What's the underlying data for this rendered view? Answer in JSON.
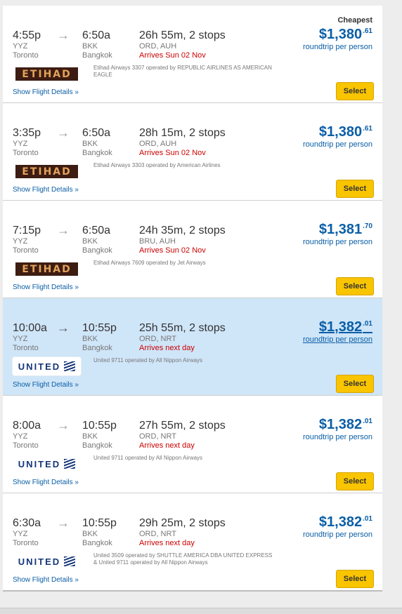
{
  "results": [
    {
      "badge": "Cheapest",
      "dep_time": "4:55p",
      "dep_code": "YYZ",
      "dep_city": "Toronto",
      "arr_time": "6:50a",
      "arr_code": "BKK",
      "arr_city": "Bangkok",
      "duration": "26h 55m, 2 stops",
      "via": "ORD, AUH",
      "arrives": "Arrives Sun 02 Nov",
      "price_main": "$1,380",
      "price_cents": ".61",
      "price_note": "roundtrip per person",
      "airline_logo": "ETIHAD",
      "operated": "Etihad Airways 3307 operated by REPUBLIC AIRLINES AS AMERICAN EAGLE",
      "details_link": "Show Flight Details",
      "select_label": "Select"
    },
    {
      "badge": "",
      "dep_time": "3:35p",
      "dep_code": "YYZ",
      "dep_city": "Toronto",
      "arr_time": "6:50a",
      "arr_code": "BKK",
      "arr_city": "Bangkok",
      "duration": "28h 15m, 2 stops",
      "via": "ORD, AUH",
      "arrives": "Arrives Sun 02 Nov",
      "price_main": "$1,380",
      "price_cents": ".61",
      "price_note": "roundtrip per person",
      "airline_logo": "ETIHAD",
      "operated": "Etihad Airways 3303 operated by American Airlines",
      "details_link": "Show Flight Details",
      "select_label": "Select"
    },
    {
      "badge": "",
      "dep_time": "7:15p",
      "dep_code": "YYZ",
      "dep_city": "Toronto",
      "arr_time": "6:50a",
      "arr_code": "BKK",
      "arr_city": "Bangkok",
      "duration": "24h 35m, 2 stops",
      "via": "BRU, AUH",
      "arrives": "Arrives Sun 02 Nov",
      "price_main": "$1,381",
      "price_cents": ".70",
      "price_note": "roundtrip per person",
      "airline_logo": "ETIHAD",
      "operated": "Etihad Airways 7609 operated by Jet Airways",
      "details_link": "Show Flight Details",
      "select_label": "Select"
    },
    {
      "badge": "",
      "dep_time": "10:00a",
      "dep_code": "YYZ",
      "dep_city": "Toronto",
      "arr_time": "10:55p",
      "arr_code": "BKK",
      "arr_city": "Bangkok",
      "duration": "25h 55m, 2 stops",
      "via": "ORD, NRT",
      "arrives": "Arrives next day",
      "price_main": "$1,382",
      "price_cents": ".01",
      "price_note": "roundtrip per person",
      "airline_logo": "UNITED",
      "operated": "United 9711 operated by All Nippon Airways",
      "details_link": "Show Flight Details",
      "select_label": "Select"
    },
    {
      "badge": "",
      "dep_time": "8:00a",
      "dep_code": "YYZ",
      "dep_city": "Toronto",
      "arr_time": "10:55p",
      "arr_code": "BKK",
      "arr_city": "Bangkok",
      "duration": "27h 55m, 2 stops",
      "via": "ORD, NRT",
      "arrives": "Arrives next day",
      "price_main": "$1,382",
      "price_cents": ".01",
      "price_note": "roundtrip per person",
      "airline_logo": "UNITED",
      "operated": "United 9711 operated by All Nippon Airways",
      "details_link": "Show Flight Details",
      "select_label": "Select"
    },
    {
      "badge": "",
      "dep_time": "6:30a",
      "dep_code": "YYZ",
      "dep_city": "Toronto",
      "arr_time": "10:55p",
      "arr_code": "BKK",
      "arr_city": "Bangkok",
      "duration": "29h 25m, 2 stops",
      "via": "ORD, NRT",
      "arrives": "Arrives next day",
      "price_main": "$1,382",
      "price_cents": ".01",
      "price_note": "roundtrip per person",
      "airline_logo": "UNITED",
      "operated": "United 3509 operated by SHUTTLE AMERICA DBA UNITED EXPRESS & United 9711 operated by All Nippon Airways",
      "details_link": "Show Flight Details",
      "select_label": "Select"
    }
  ],
  "icons": {
    "arrow": "right-arrow-icon",
    "chevron": "double-chevron-down-icon",
    "globe": "united-globe-icon"
  },
  "colors": {
    "price": "#0a5ea6",
    "arrives": "#cc0000",
    "select": "#f9c400",
    "highlight_row": "#cfe5f8"
  }
}
